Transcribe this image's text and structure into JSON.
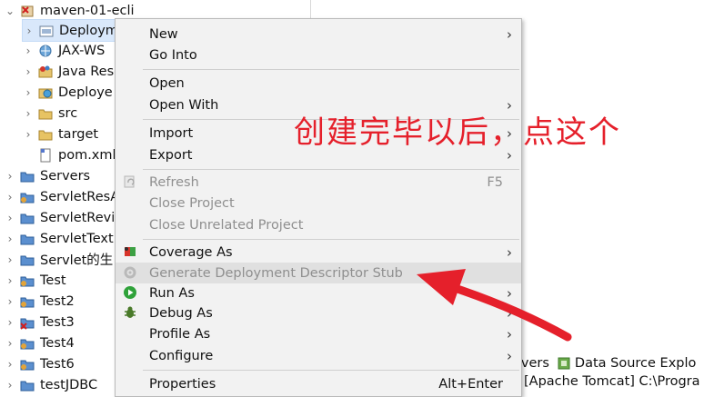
{
  "tree": {
    "project": "maven-01-ecli",
    "children": [
      {
        "label": "Deploym",
        "selected": true
      },
      {
        "label": "JAX-WS"
      },
      {
        "label": "Java Reso"
      },
      {
        "label": "Deploye"
      },
      {
        "label": "src"
      },
      {
        "label": "target"
      },
      {
        "label": "pom.xml"
      }
    ],
    "projects": [
      {
        "label": "Servers"
      },
      {
        "label": "ServletResA"
      },
      {
        "label": "ServletRevi"
      },
      {
        "label": "ServletText"
      },
      {
        "label": "Servlet的生"
      },
      {
        "label": "Test"
      },
      {
        "label": "Test2"
      },
      {
        "label": "Test3"
      },
      {
        "label": "Test4"
      },
      {
        "label": "Test6"
      },
      {
        "label": "testJDBC"
      }
    ]
  },
  "menu": {
    "new": "New",
    "go_into": "Go Into",
    "open": "Open",
    "open_with": "Open With",
    "import": "Import",
    "export": "Export",
    "refresh": "Refresh",
    "refresh_accel": "F5",
    "close_project": "Close Project",
    "close_unrelated": "Close Unrelated Project",
    "coverage_as": "Coverage As",
    "generate_dd": "Generate Deployment Descriptor Stub",
    "run_as": "Run As",
    "debug_as": "Debug As",
    "profile_as": "Profile As",
    "configure": "Configure",
    "properties": "Properties",
    "properties_accel": "Alt+Enter",
    "submenu_glyph": "›"
  },
  "bottom": {
    "servers_tab": "ervers",
    "datasource_tab": "Data Source Explo",
    "server_entry": "[Apache Tomcat] C:\\Progra"
  },
  "annotation": {
    "text": "创建完毕以后，点这个",
    "color": "#e5202b"
  }
}
